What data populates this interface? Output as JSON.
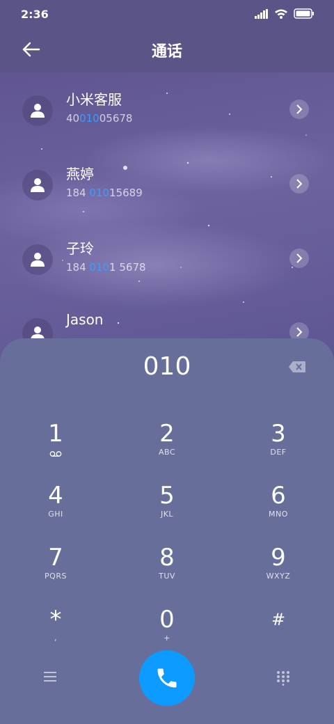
{
  "status": {
    "time": "2:36"
  },
  "header": {
    "title": "通话",
    "back_icon": "arrow-left-icon"
  },
  "contacts": [
    {
      "name": "小米客服",
      "num_pre": "40",
      "num_hl": "010",
      "num_post": "05678"
    },
    {
      "name": "燕婷",
      "num_pre": "184 ",
      "num_hl": "010",
      "num_post": "15689"
    },
    {
      "name": "子玲",
      "num_pre": "184 ",
      "num_hl": "010",
      "num_post": "1 5678"
    },
    {
      "name": "Jason",
      "num_pre": "",
      "num_hl": "",
      "num_post": ""
    }
  ],
  "dialpad": {
    "input": "010",
    "keys": [
      {
        "digit": "1",
        "letters": "voicemail"
      },
      {
        "digit": "2",
        "letters": "ABC"
      },
      {
        "digit": "3",
        "letters": "DEF"
      },
      {
        "digit": "4",
        "letters": "GHI"
      },
      {
        "digit": "5",
        "letters": "JKL"
      },
      {
        "digit": "6",
        "letters": "MNO"
      },
      {
        "digit": "7",
        "letters": "PQRS"
      },
      {
        "digit": "8",
        "letters": "TUV"
      },
      {
        "digit": "9",
        "letters": "WXYZ"
      },
      {
        "digit": "*",
        "letters": ","
      },
      {
        "digit": "0",
        "letters": "+"
      },
      {
        "digit": "#",
        "letters": ""
      }
    ]
  },
  "colors": {
    "accent": "#0d9bff",
    "highlight": "#3b9dff",
    "dialpad_bg": "#666e99"
  }
}
